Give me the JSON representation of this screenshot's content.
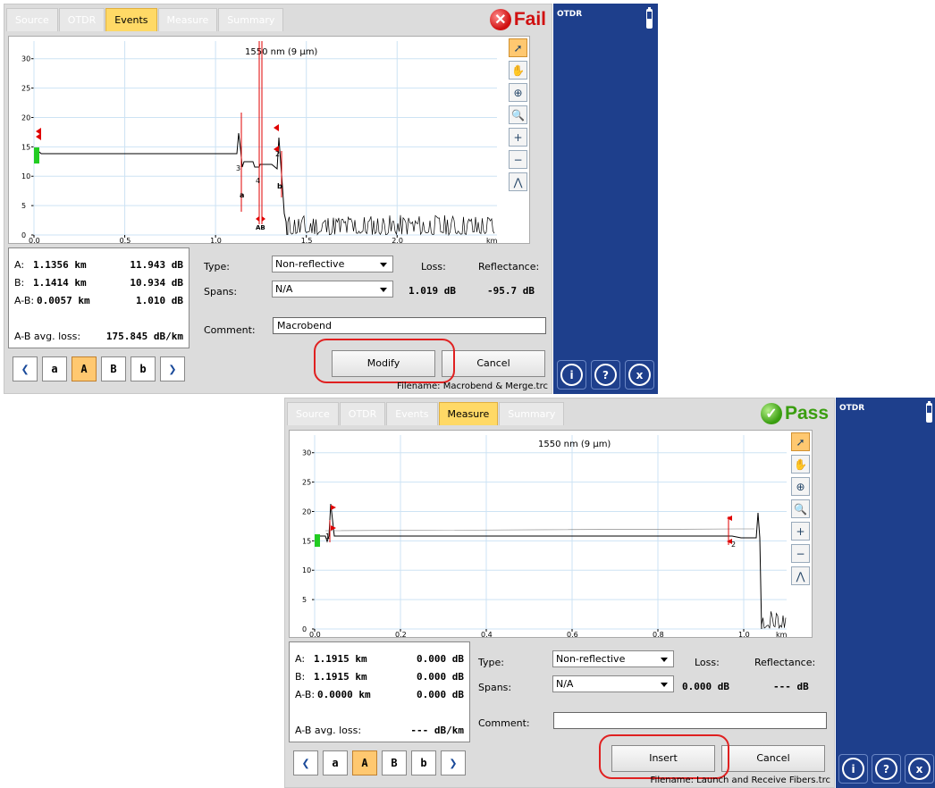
{
  "screens": [
    {
      "tabs": [
        "Source",
        "OTDR",
        "Events",
        "Measure",
        "Summary"
      ],
      "active_tab": "Events",
      "status": {
        "label": "Fail",
        "icon": "x-icon",
        "color": "#d01010"
      },
      "graph_title": "1550 nm (9 µm)",
      "graph_x_unit": "km",
      "graph_x_ticks": [
        "0.0",
        "0.5",
        "1.0",
        "1.5",
        "2.0"
      ],
      "graph_y_ticks": [
        "0",
        "5",
        "10",
        "15",
        "20",
        "25",
        "30"
      ],
      "event_labels": {
        "e2": "2",
        "e3": "3",
        "e4": "4",
        "ma": "a",
        "mb": "b",
        "ab": "AB"
      },
      "info": {
        "a_label": "A:",
        "a_km": "1.1356 km",
        "a_db": "11.943 dB",
        "b_label": "B:",
        "b_km": "1.1414 km",
        "b_db": "10.934 dB",
        "ab_label": "A-B:",
        "ab_km": "0.0057 km",
        "ab_db": "1.010 dB",
        "avg_label": "A-B avg. loss:",
        "avg_value": "175.845 dB/km"
      },
      "form": {
        "type_label": "Type:",
        "type_value": "Non-reflective",
        "spans_label": "Spans:",
        "spans_value": "N/A",
        "loss_label": "Loss:",
        "loss_value": "1.019 dB",
        "refl_label": "Reflectance:",
        "refl_value": "-95.7 dB",
        "comment_label": "Comment:",
        "comment_value": "Macrobend"
      },
      "nav": {
        "prev": "❮",
        "a": "a",
        "A": "A",
        "B": "B",
        "b": "b",
        "next": "❯"
      },
      "primary_button": "Modify",
      "cancel_button": "Cancel",
      "filename": "Filename: Macrobend & Merge.trc",
      "side_title": "OTDR",
      "side_buttons": [
        "i",
        "?",
        "x"
      ]
    },
    {
      "tabs": [
        "Source",
        "OTDR",
        "Events",
        "Measure",
        "Summary"
      ],
      "active_tab": "Measure",
      "status": {
        "label": "Pass",
        "icon": "check-icon",
        "color": "#3a9e10"
      },
      "graph_title": "1550 nm (9 µm)",
      "graph_x_unit": "km",
      "graph_x_ticks": [
        "0.0",
        "0.2",
        "0.4",
        "0.6",
        "0.8",
        "1.0"
      ],
      "graph_y_ticks": [
        "0",
        "5",
        "10",
        "15",
        "20",
        "25",
        "30"
      ],
      "event_labels": {
        "e1": "1",
        "e2": "2"
      },
      "info": {
        "a_label": "A:",
        "a_km": "1.1915 km",
        "a_db": "0.000 dB",
        "b_label": "B:",
        "b_km": "1.1915 km",
        "b_db": "0.000 dB",
        "ab_label": "A-B:",
        "ab_km": "0.0000 km",
        "ab_db": "0.000 dB",
        "avg_label": "A-B avg. loss:",
        "avg_value": "--- dB/km"
      },
      "form": {
        "type_label": "Type:",
        "type_value": "Non-reflective",
        "spans_label": "Spans:",
        "spans_value": "N/A",
        "loss_label": "Loss:",
        "loss_value": "0.000 dB",
        "refl_label": "Reflectance:",
        "refl_value": "--- dB",
        "comment_label": "Comment:",
        "comment_value": ""
      },
      "nav": {
        "prev": "❮",
        "a": "a",
        "A": "A",
        "B": "B",
        "b": "b",
        "next": "❯"
      },
      "primary_button": "Insert",
      "cancel_button": "Cancel",
      "filename": "Filename: Launch and Receive Fibers.trc",
      "side_title": "OTDR",
      "side_buttons": [
        "i",
        "?",
        "x"
      ]
    }
  ],
  "tool_icons": [
    "arrow-pointer-icon",
    "hand-pan-icon",
    "zoom-area-icon",
    "zoom-fit-icon",
    "zoom-in-icon",
    "zoom-out-icon",
    "peak-view-icon"
  ]
}
